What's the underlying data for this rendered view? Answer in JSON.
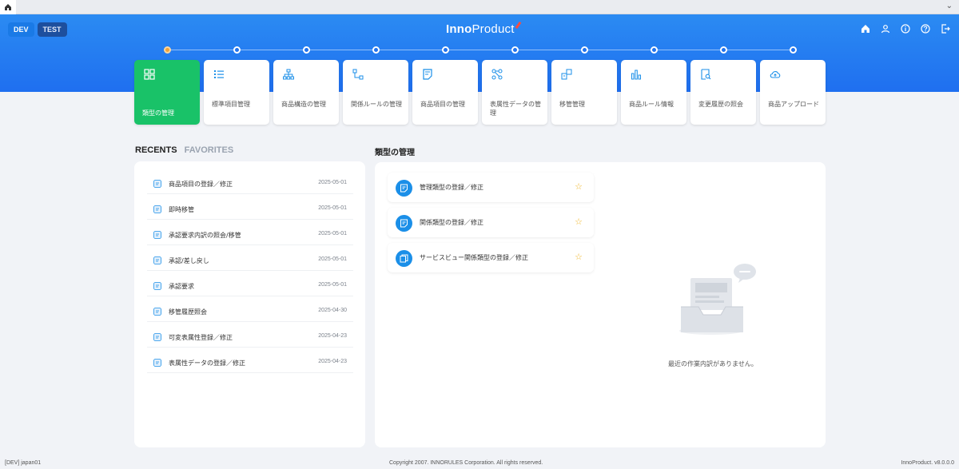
{
  "env": {
    "dev": "DEV",
    "test": "TEST"
  },
  "logo": {
    "bold": "Inno",
    "light": "Product"
  },
  "header_icons": [
    "home-icon",
    "user-icon",
    "info-icon",
    "help-icon",
    "logout-icon"
  ],
  "cards": [
    {
      "label": "類型の管理",
      "icon": "grid-icon",
      "active": true
    },
    {
      "label": "標準項目管理",
      "icon": "list-icon"
    },
    {
      "label": "商品構造の管理",
      "icon": "hierarchy-icon"
    },
    {
      "label": "関係ルールの管理",
      "icon": "relation-icon"
    },
    {
      "label": "商品項目の管理",
      "icon": "document-icon"
    },
    {
      "label": "表属性データの管理",
      "icon": "share-icon"
    },
    {
      "label": "移管管理",
      "icon": "transfer-icon"
    },
    {
      "label": "商品ルール情報",
      "icon": "bar-chart-icon"
    },
    {
      "label": "変更履歴の照会",
      "icon": "search-doc-icon"
    },
    {
      "label": "商品アップロード",
      "icon": "cloud-upload-icon"
    }
  ],
  "tabs": {
    "recents": "RECENTS",
    "favorites": "FAVORITES"
  },
  "recents": [
    {
      "label": "商品項目の登録／修正",
      "date": "2025-05-01"
    },
    {
      "label": "即時移管",
      "date": "2025-05-01"
    },
    {
      "label": "承認要求内訳の照会/移管",
      "date": "2025-05-01"
    },
    {
      "label": "承認/差し戻し",
      "date": "2025-05-01"
    },
    {
      "label": "承認要求",
      "date": "2025-05-01"
    },
    {
      "label": "移管履歴照会",
      "date": "2025-04-30"
    },
    {
      "label": "可変表属性登録／修正",
      "date": "2025-04-23"
    },
    {
      "label": "表属性データの登録／修正",
      "date": "2025-04-23"
    }
  ],
  "main": {
    "title": "類型の管理",
    "items": [
      {
        "label": "管理類型の登録／修正"
      },
      {
        "label": "関係類型の登録／修正"
      },
      {
        "label": "サービスビュー関係類型の登録／修正"
      }
    ],
    "empty_text": "最近の作業内訳がありません。"
  },
  "footer": {
    "left": "[DEV] japan01",
    "center": "Copyright 2007. INNORULES Corporation. All rights reserved.",
    "right": "InnoProduct. v8.0.0.0"
  }
}
